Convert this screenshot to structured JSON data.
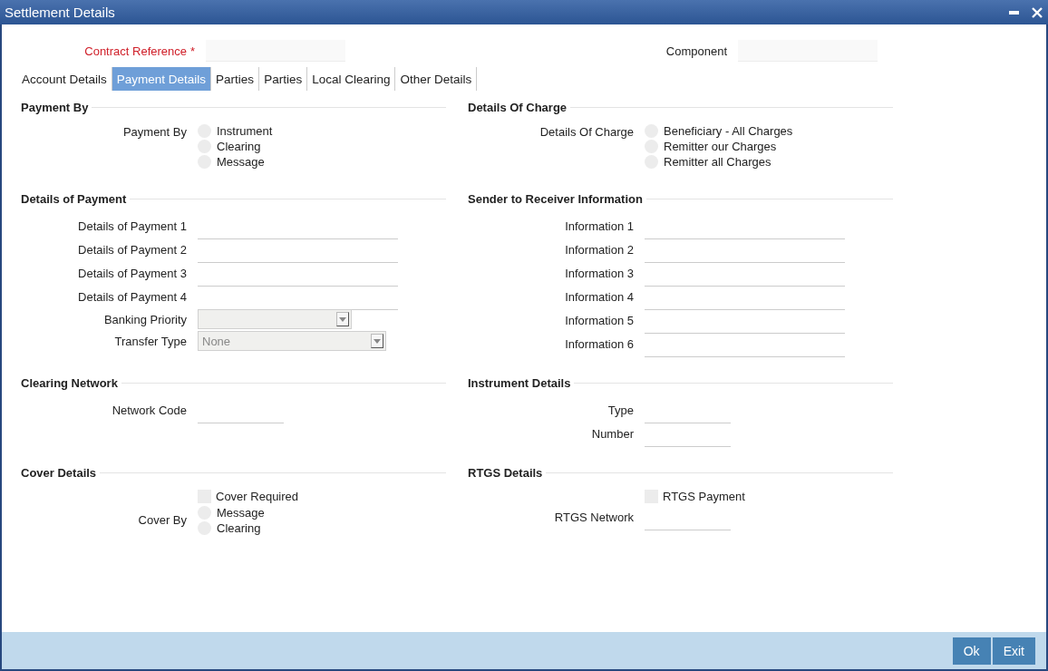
{
  "window": {
    "title": "Settlement Details"
  },
  "header_fields": [
    {
      "label": "Contract Reference",
      "required_mark": "*"
    },
    {
      "label": "Component"
    }
  ],
  "tabs": [
    {
      "label": "Account Details",
      "selected": false
    },
    {
      "label": "Payment Details",
      "selected": true
    },
    {
      "label": "Parties",
      "selected": false
    },
    {
      "label": "Parties",
      "selected": false
    },
    {
      "label": "Local Clearing",
      "selected": false
    },
    {
      "label": "Other Details",
      "selected": false
    }
  ],
  "sections": [
    {
      "title": "Payment By",
      "fields": [
        {
          "kind": "radio_group",
          "label": "Payment By",
          "options": [
            {
              "label": "Instrument",
              "selected": false
            },
            {
              "label": "Clearing",
              "selected": false
            },
            {
              "label": "Message",
              "selected": false
            }
          ]
        }
      ]
    },
    {
      "title": "Details Of Charge",
      "fields": [
        {
          "kind": "radio_group",
          "label": "Details Of Charge",
          "options": [
            {
              "label": "Beneficiary - All Charges",
              "selected": false
            },
            {
              "label": "Remitter our Charges",
              "selected": false
            },
            {
              "label": "Remitter all Charges",
              "selected": false
            }
          ]
        }
      ]
    },
    {
      "title": "Details of Payment",
      "fields": [
        {
          "kind": "text",
          "label": "Details of Payment 1"
        },
        {
          "kind": "text",
          "label": "Details of Payment 2"
        },
        {
          "kind": "text",
          "label": "Details of Payment 3"
        },
        {
          "kind": "text",
          "label": "Details of Payment 4"
        },
        {
          "kind": "select",
          "label": "Banking Priority"
        },
        {
          "kind": "select",
          "label": "Transfer Type",
          "value": "None"
        }
      ]
    },
    {
      "title": "Sender to Receiver Information",
      "fields": [
        {
          "kind": "text",
          "label": "Information 1"
        },
        {
          "kind": "text",
          "label": "Information 2"
        },
        {
          "kind": "text",
          "label": "Information 3"
        },
        {
          "kind": "text",
          "label": "Information 4"
        },
        {
          "kind": "text",
          "label": "Information 5"
        },
        {
          "kind": "text",
          "label": "Information 6"
        }
      ]
    },
    {
      "title": "Clearing Network",
      "fields": [
        {
          "kind": "text",
          "label": "Network Code"
        }
      ]
    },
    {
      "title": "Instrument Details",
      "fields": [
        {
          "kind": "text",
          "label": "Type"
        },
        {
          "kind": "text",
          "label": "Number"
        }
      ]
    },
    {
      "title": "Cover Details",
      "fields": [
        {
          "kind": "checkbox",
          "label": "Cover Required",
          "checked": false
        },
        {
          "kind": "radio_group",
          "label": "Cover By",
          "options": [
            {
              "label": "Message",
              "selected": false
            },
            {
              "label": "Clearing",
              "selected": false
            }
          ]
        }
      ]
    },
    {
      "title": "RTGS Details",
      "fields": [
        {
          "kind": "checkbox",
          "label": "RTGS Payment",
          "checked": false
        },
        {
          "kind": "text",
          "label": "RTGS Network"
        }
      ]
    }
  ],
  "buttons": [
    "Ok",
    "Exit"
  ]
}
